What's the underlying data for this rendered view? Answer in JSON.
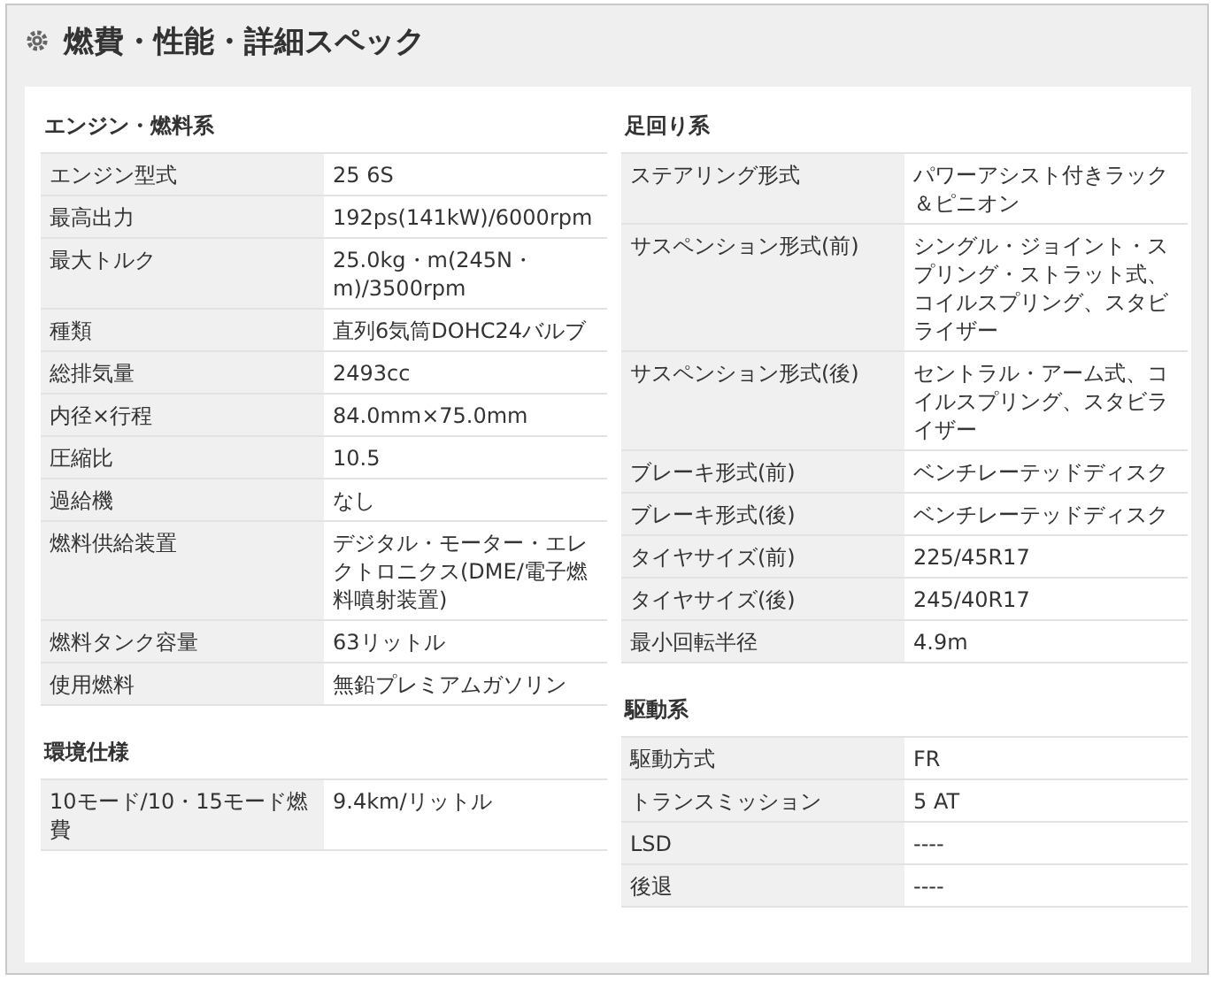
{
  "title": "燃費・性能・詳細スペック",
  "columns": [
    {
      "sections": [
        {
          "title": "エンジン・燃料系",
          "rows": [
            {
              "label": "エンジン型式",
              "value": "25 6S"
            },
            {
              "label": "最高出力",
              "value": "192ps(141kW)/6000rpm"
            },
            {
              "label": "最大トルク",
              "value": "25.0kg・m(245N・m)/3500rpm"
            },
            {
              "label": "種類",
              "value": "直列6気筒DOHC24バルブ"
            },
            {
              "label": "総排気量",
              "value": "2493cc"
            },
            {
              "label": "内径×行程",
              "value": "84.0mm×75.0mm"
            },
            {
              "label": "圧縮比",
              "value": "10.5"
            },
            {
              "label": "過給機",
              "value": "なし"
            },
            {
              "label": "燃料供給装置",
              "value": "デジタル・モーター・エレクトロニクス(DME/電子燃料噴射装置)"
            },
            {
              "label": "燃料タンク容量",
              "value": "63リットル"
            },
            {
              "label": "使用燃料",
              "value": "無鉛プレミアムガソリン"
            }
          ]
        },
        {
          "title": "環境仕様",
          "rows": [
            {
              "label": "10モード/10・15モード燃費",
              "value": "9.4km/リットル"
            }
          ]
        }
      ]
    },
    {
      "sections": [
        {
          "title": "足回り系",
          "rows": [
            {
              "label": "ステアリング形式",
              "value": "パワーアシスト付きラック＆ピニオン"
            },
            {
              "label": "サスペンション形式(前)",
              "value": "シングル・ジョイント・スプリング・ストラット式、コイルスプリング、スタビライザー"
            },
            {
              "label": "サスペンション形式(後)",
              "value": "セントラル・アーム式、コイルスプリング、スタビライザー"
            },
            {
              "label": "ブレーキ形式(前)",
              "value": "ベンチレーテッドディスク"
            },
            {
              "label": "ブレーキ形式(後)",
              "value": "ベンチレーテッドディスク"
            },
            {
              "label": "タイヤサイズ(前)",
              "value": "225/45R17"
            },
            {
              "label": "タイヤサイズ(後)",
              "value": "245/40R17"
            },
            {
              "label": "最小回転半径",
              "value": "4.9m"
            }
          ]
        },
        {
          "title": "駆動系",
          "rows": [
            {
              "label": "駆動方式",
              "value": "FR"
            },
            {
              "label": "トランスミッション",
              "value": "5 AT"
            },
            {
              "label": "LSD",
              "value": "----"
            },
            {
              "label": "後退",
              "value": "----"
            }
          ]
        }
      ]
    }
  ]
}
